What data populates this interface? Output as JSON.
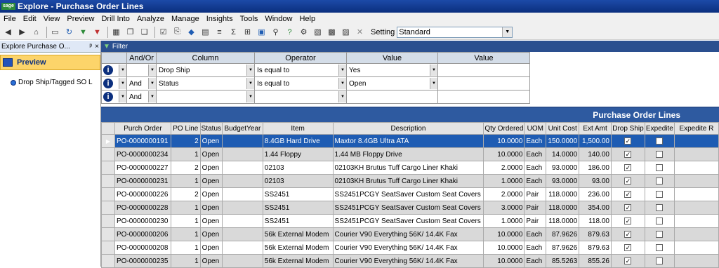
{
  "window": {
    "logo": "sage",
    "title": "Explore - Purchase Order Lines"
  },
  "menu": [
    "File",
    "Edit",
    "View",
    "Preview",
    "Drill Into",
    "Analyze",
    "Manage",
    "Insights",
    "Tools",
    "Window",
    "Help"
  ],
  "toolbar": {
    "setting_label": "Setting",
    "setting_value": "Standard"
  },
  "left_panel": {
    "title": "Explore  Purchase  O...",
    "pin": "ᵖ",
    "close": "×",
    "preview_label": "Preview",
    "tree_item": "Drop Ship/Tagged SO L"
  },
  "filter": {
    "title": "Filter",
    "headers": [
      "And/Or",
      "Column",
      "Operator",
      "Value",
      "Value"
    ],
    "rows": [
      {
        "andor": "",
        "column": "Drop Ship",
        "operator": "Is equal to",
        "value": "Yes",
        "value2": ""
      },
      {
        "andor": "And",
        "column": "Status",
        "operator": "Is equal to",
        "value": "Open",
        "value2": ""
      },
      {
        "andor": "And",
        "column": "",
        "operator": "",
        "value": "",
        "value2": ""
      }
    ]
  },
  "grid": {
    "title": "Purchase Order Lines",
    "headers": [
      "Purch Order",
      "PO Line",
      "Status",
      "BudgetYear",
      "Item",
      "Description",
      "Qty Ordered",
      "UOM",
      "Unit Cost",
      "Ext Amt",
      "Drop Ship",
      "Expedite",
      "Expedite R"
    ],
    "rows": [
      {
        "po": "PO-0000000191",
        "line": "2",
        "status": "Open",
        "budget": "",
        "item": "8.4GB Hard Drive",
        "desc": "Maxtor 8.4GB Ultra ATA",
        "qty": "10.0000",
        "uom": "Each",
        "unit": "150.0000",
        "ext": "1,500.00",
        "drop": true,
        "exp": false
      },
      {
        "po": "PO-0000000234",
        "line": "1",
        "status": "Open",
        "budget": "",
        "item": "1.44 Floppy",
        "desc": "1.44 MB Floppy Drive",
        "qty": "10.0000",
        "uom": "Each",
        "unit": "14.0000",
        "ext": "140.00",
        "drop": true,
        "exp": false
      },
      {
        "po": "PO-0000000227",
        "line": "2",
        "status": "Open",
        "budget": "",
        "item": "02103",
        "desc": "02103KH Brutus Tuff Cargo Liner Khaki",
        "qty": "2.0000",
        "uom": "Each",
        "unit": "93.0000",
        "ext": "186.00",
        "drop": true,
        "exp": false
      },
      {
        "po": "PO-0000000231",
        "line": "1",
        "status": "Open",
        "budget": "",
        "item": "02103",
        "desc": "02103KH Brutus Tuff Cargo Liner Khaki",
        "qty": "1.0000",
        "uom": "Each",
        "unit": "93.0000",
        "ext": "93.00",
        "drop": true,
        "exp": false
      },
      {
        "po": "PO-0000000226",
        "line": "2",
        "status": "Open",
        "budget": "",
        "item": "SS2451",
        "desc": "SS2451PCGY  SeatSaver Custom Seat Covers",
        "qty": "2.0000",
        "uom": "Pair",
        "unit": "118.0000",
        "ext": "236.00",
        "drop": true,
        "exp": false
      },
      {
        "po": "PO-0000000228",
        "line": "1",
        "status": "Open",
        "budget": "",
        "item": "SS2451",
        "desc": "SS2451PCGY  SeatSaver Custom Seat Covers",
        "qty": "3.0000",
        "uom": "Pair",
        "unit": "118.0000",
        "ext": "354.00",
        "drop": true,
        "exp": false
      },
      {
        "po": "PO-0000000230",
        "line": "1",
        "status": "Open",
        "budget": "",
        "item": "SS2451",
        "desc": "SS2451PCGY  SeatSaver Custom Seat Covers",
        "qty": "1.0000",
        "uom": "Pair",
        "unit": "118.0000",
        "ext": "118.00",
        "drop": true,
        "exp": false
      },
      {
        "po": "PO-0000000206",
        "line": "1",
        "status": "Open",
        "budget": "",
        "item": "56k External Modem",
        "desc": "Courier V90 Everything 56K/ 14.4K Fax",
        "qty": "10.0000",
        "uom": "Each",
        "unit": "87.9626",
        "ext": "879.63",
        "drop": true,
        "exp": false
      },
      {
        "po": "PO-0000000208",
        "line": "1",
        "status": "Open",
        "budget": "",
        "item": "56k External Modem",
        "desc": "Courier V90 Everything 56K/ 14.4K Fax",
        "qty": "10.0000",
        "uom": "Each",
        "unit": "87.9626",
        "ext": "879.63",
        "drop": true,
        "exp": false
      },
      {
        "po": "PO-0000000235",
        "line": "1",
        "status": "Open",
        "budget": "",
        "item": "56k External Modem",
        "desc": "Courier V90 Everything 56K/ 14.4K Fax",
        "qty": "10.0000",
        "uom": "Each",
        "unit": "85.5263",
        "ext": "855.26",
        "drop": true,
        "exp": false
      }
    ]
  }
}
